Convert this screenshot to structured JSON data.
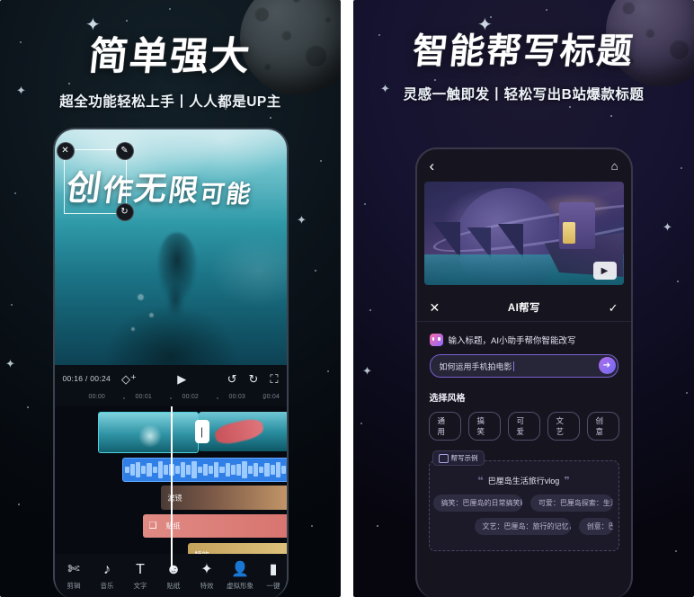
{
  "left_panel": {
    "headline": "简单强大",
    "subhead": "超全功能轻松上手丨人人都是UP主",
    "video": {
      "overlay_chars": [
        "创",
        "作",
        "无",
        "限",
        "可",
        "能"
      ],
      "handle_close": "✕",
      "handle_edit": "✎",
      "handle_rotate": "↻"
    },
    "controls": {
      "timecode": "00:16 / 00:24",
      "keyframe_icon": "◇⁺",
      "play_icon": "▶",
      "undo_icon": "↺",
      "redo_icon": "↻",
      "fullscreen_icon": "⛶"
    },
    "ruler_ticks": [
      "00:00",
      "00:01",
      "00:02",
      "00:03",
      "00:04"
    ],
    "tracks": [
      {
        "name": "video-clip-1",
        "label": ""
      },
      {
        "name": "video-clip-2",
        "label": ""
      },
      {
        "name": "audio-track",
        "label": ""
      },
      {
        "name": "filter-track",
        "label": "滤镜"
      },
      {
        "name": "sticker-track",
        "label": "贴纸"
      },
      {
        "name": "effect-track",
        "label": "特效"
      }
    ],
    "toolbar": [
      {
        "label": "剪辑",
        "icon": "✄"
      },
      {
        "label": "音乐",
        "icon": "♪"
      },
      {
        "label": "文字",
        "icon": "T"
      },
      {
        "label": "贴纸",
        "icon": "☻"
      },
      {
        "label": "特效",
        "icon": "✦"
      },
      {
        "label": "虚拟形象",
        "icon": "👤"
      },
      {
        "label": "一键",
        "icon": "▮"
      }
    ]
  },
  "right_panel": {
    "headline": "智能帮写标题",
    "subhead": "灵感一触即发丨轻松写出B站爆款标题",
    "nav": {
      "back_icon": "‹",
      "home_icon": "⌂"
    },
    "preview": {
      "play_icon": "▶"
    },
    "ai_bar": {
      "close_icon": "✕",
      "title": "AI帮写",
      "confirm_icon": "✓"
    },
    "hint": "输入标题，AI小助手帮你智能改写",
    "input": {
      "value": "如何运用手机拍电影",
      "send_icon": "➔"
    },
    "style_section_title": "选择风格",
    "style_chips": [
      "通用",
      "搞笑",
      "可爱",
      "文艺",
      "创意"
    ],
    "examples": {
      "tab_label": "帮写示例",
      "quote_open": "❝",
      "quote_close": "❞",
      "quote_text": "巴厘岛生活旅行vlog",
      "rows": [
        [
          "搞笑：巴厘岛的日常搞笑瞬间!",
          "可爱：巴厘岛探索：生活与"
        ],
        [
          "文艺：巴厘岛：旅行的记忆，生活的诗篇",
          "创意：巴"
        ]
      ]
    }
  },
  "colors": {
    "left_bg": "#0d161d",
    "right_bg": "#151330",
    "accent_purple": "#7b5fd0",
    "accent_blue": "#2f7fe6",
    "sticker_red": "#e08a84",
    "effect_gold": "#c3a25c"
  }
}
